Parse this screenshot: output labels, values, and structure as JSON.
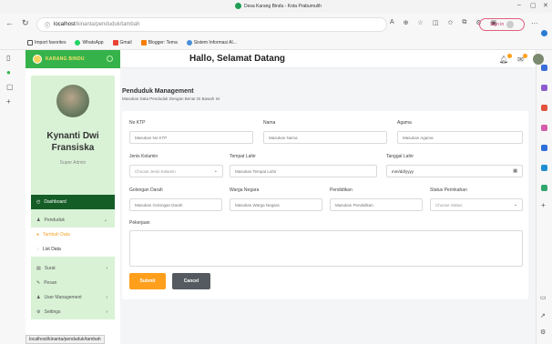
{
  "browser": {
    "tab_title": "Desa Karang Bindu - Kota Prabumulih",
    "url_host": "localhost",
    "url_path": "/kinanta/penduduk/tambah",
    "sign_in": "Sign in",
    "status_url": "localhost/kinanta/penduduk/tambah",
    "bookmarks": [
      {
        "label": "Import favorites",
        "icon": "import-icon",
        "color": "#555555"
      },
      {
        "label": "WhatsApp",
        "icon": "whatsapp-icon",
        "color": "#25d366"
      },
      {
        "label": "Gmail",
        "icon": "gmail-icon",
        "color": "#ea4335"
      },
      {
        "label": "Blogger: Tema",
        "icon": "blogger-icon",
        "color": "#f57d00"
      },
      {
        "label": "Sistem Informasi Al...",
        "icon": "globe-icon",
        "color": "#4a90d9"
      }
    ]
  },
  "app": {
    "brand": "KARANG BINDU",
    "greeting": "Hallo, Selamat Datang",
    "accent": "#36b24a",
    "dark_green": "#155d27",
    "orange": "#ff9f1c"
  },
  "profile": {
    "name": "Kynanti Dwi Fransiska",
    "role": "Super Admin"
  },
  "sidebar": {
    "dashboard": "Dashboard",
    "penduduk": "Penduduk",
    "tambah": "Tambah Data",
    "list": "List Data",
    "surat": "Surat",
    "pesan": "Pesan",
    "user": "User Management",
    "settings": "Settings"
  },
  "page": {
    "title": "Penduduk Management",
    "subtitle": "Masukan Data Penduduk Dengan Benar Di Bawah Ini"
  },
  "form": {
    "ktp_label": "No KTP",
    "ktp_ph": "Masukan No KTP",
    "nama_label": "Nama",
    "nama_ph": "Masukan Nama",
    "agama_label": "Agama",
    "agama_ph": "Masukan Agama",
    "jk_label": "Jenis Kelamin",
    "jk_value": "Choose Jenis Kelamin",
    "tl_label": "Tempat Lahir",
    "tl_ph": "Masukan Tempat Lahir",
    "tgl_label": "Tanggal Lahir",
    "tgl_value": "mm/dd/yyyy",
    "gd_label": "Golongan Darah",
    "gd_ph": "Masukan Golongan Darah",
    "wn_label": "Warga Negara",
    "wn_ph": "Masukan Warga Negara",
    "pend_label": "Pendidikan",
    "pend_ph": "Masukan Pendidikan",
    "sp_label": "Status Perinkahan",
    "sp_value": "Choose Status",
    "pek_label": "Pekerjaan",
    "submit": "Submit",
    "cancel": "Cancel"
  }
}
